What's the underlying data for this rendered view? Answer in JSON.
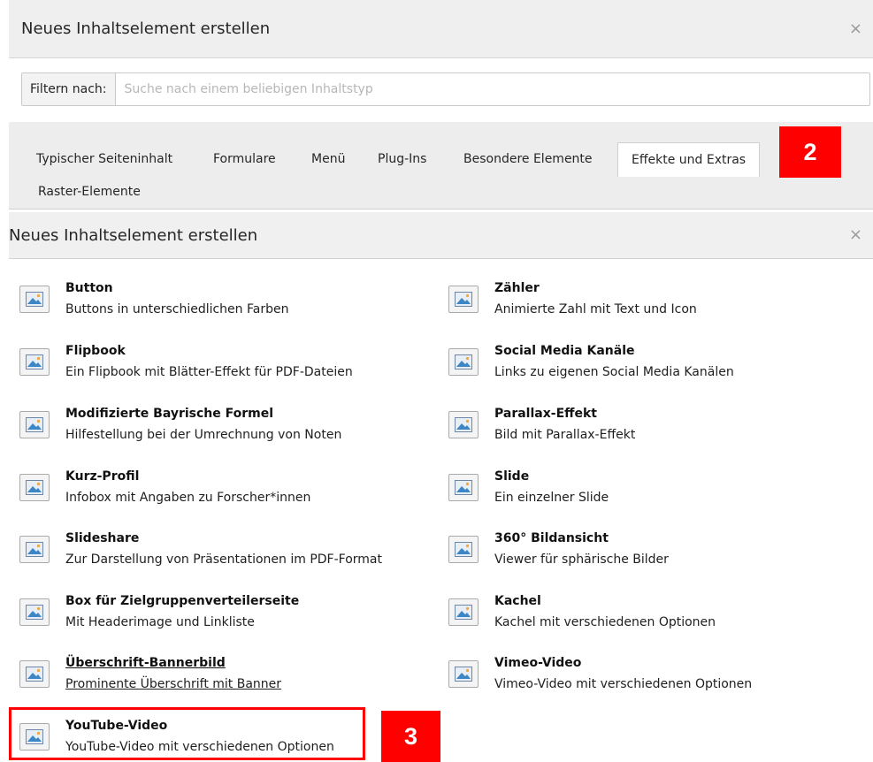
{
  "top_modal": {
    "title": "Neues Inhaltselement erstellen",
    "close": "×",
    "filter_label": "Filtern nach:",
    "filter_placeholder": "Suche nach einem beliebigen Inhaltstyp",
    "filter_value": "",
    "tabs": [
      {
        "label": "Typischer Seiteninhalt",
        "active": false
      },
      {
        "label": "Formulare",
        "active": false
      },
      {
        "label": "Menü",
        "active": false
      },
      {
        "label": "Plug-Ins",
        "active": false
      },
      {
        "label": "Besondere Elemente",
        "active": false
      },
      {
        "label": "Effekte und Extras",
        "active": true
      },
      {
        "label": "Raster-Elemente",
        "active": false
      }
    ]
  },
  "annotations": {
    "badge_2": "2",
    "badge_3": "3",
    "color": "#ff0000"
  },
  "bottom_modal": {
    "title": "Neues Inhaltselement erstellen",
    "close": "×",
    "left_column": [
      {
        "title": "Button",
        "description": "Buttons in unterschiedlichen Farben"
      },
      {
        "title": "Flipbook",
        "description": "Ein Flipbook mit Blätter-Effekt für PDF-Dateien"
      },
      {
        "title": "Modifizierte Bayrische Formel",
        "description": "Hilfestellung bei der Umrechnung von Noten"
      },
      {
        "title": "Kurz-Profil",
        "description": "Infobox mit Angaben zu Forscher*innen"
      },
      {
        "title": "Slideshare",
        "description": "Zur Darstellung von Präsentationen im PDF-Format"
      },
      {
        "title": "Box für Zielgruppenverteilerseite",
        "description": "Mit Headerimage und Linkliste"
      },
      {
        "title": "Überschrift-Bannerbild",
        "description": "Prominente Überschrift mit Banner"
      },
      {
        "title": "YouTube-Video",
        "description": "YouTube-Video mit verschiedenen Optionen"
      }
    ],
    "right_column": [
      {
        "title": "Zähler",
        "description": "Animierte Zahl mit Text und Icon"
      },
      {
        "title": "Social Media Kanäle",
        "description": "Links zu eigenen Social Media Kanälen"
      },
      {
        "title": "Parallax-Effekt",
        "description": "Bild mit Parallax-Effekt"
      },
      {
        "title": "Slide",
        "description": "Ein einzelner Slide"
      },
      {
        "title": "360° Bildansicht",
        "description": "Viewer für sphärische Bilder"
      },
      {
        "title": "Kachel",
        "description": "Kachel mit verschiedenen Optionen"
      },
      {
        "title": "Vimeo-Video",
        "description": "Vimeo-Video mit verschiedenen Optionen"
      }
    ],
    "icon": "content-element-image-icon"
  }
}
